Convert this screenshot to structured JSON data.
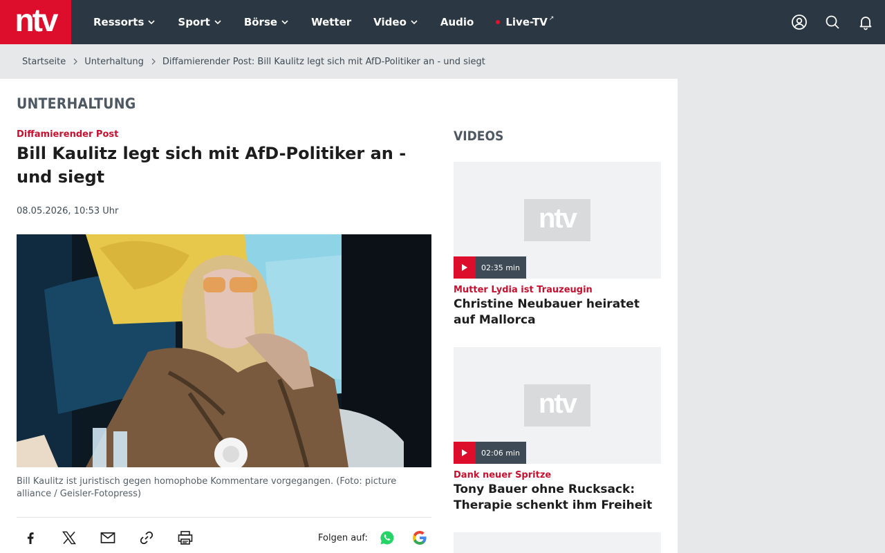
{
  "header": {
    "logo": "ntv",
    "nav": [
      {
        "label": "Ressorts",
        "dropdown": true
      },
      {
        "label": "Sport",
        "dropdown": true
      },
      {
        "label": "Börse",
        "dropdown": true
      },
      {
        "label": "Wetter",
        "dropdown": false
      },
      {
        "label": "Video",
        "dropdown": true
      },
      {
        "label": "Audio",
        "dropdown": false
      },
      {
        "label": "Live-TV",
        "dropdown": false
      }
    ],
    "icons": [
      "user-icon",
      "search-icon",
      "bell-icon"
    ]
  },
  "breadcrumb": [
    "Startseite",
    "Unterhaltung",
    "Diffamierender Post: Bill Kaulitz legt sich mit AfD-Politiker an - und siegt"
  ],
  "article": {
    "section": "UNTERHALTUNG",
    "kicker": "Diffamierender Post",
    "headline": "Bill Kaulitz legt sich mit AfD-Politiker an - und siegt",
    "date": "08.05.2026, 10:53 Uhr",
    "caption": "Bill Kaulitz ist juristisch gegen homophobe Kommentare vorgegangen. (Foto: picture alliance / Geisler-Fotopress)",
    "share_icons": [
      "facebook-icon",
      "x-icon",
      "mail-icon",
      "link-icon",
      "print-icon"
    ],
    "follow_label": "Folgen auf:",
    "follow_icons": [
      "whatsapp-icon",
      "google-icon"
    ]
  },
  "videos": {
    "title": "VIDEOS",
    "items": [
      {
        "duration": "02:35 min",
        "kicker": "Mutter Lydia ist Trauzeugin",
        "title": "Christine Neubauer heiratet auf Mallorca"
      },
      {
        "duration": "02:06 min",
        "kicker": "Dank neuer Spritze",
        "title": "Tony Bauer ohne Rucksack: Therapie schenkt ihm Freiheit"
      }
    ]
  },
  "colors": {
    "brand_red": "#dd0d2c",
    "header_bg": "#2b3742",
    "kicker_red": "#c8102e"
  }
}
